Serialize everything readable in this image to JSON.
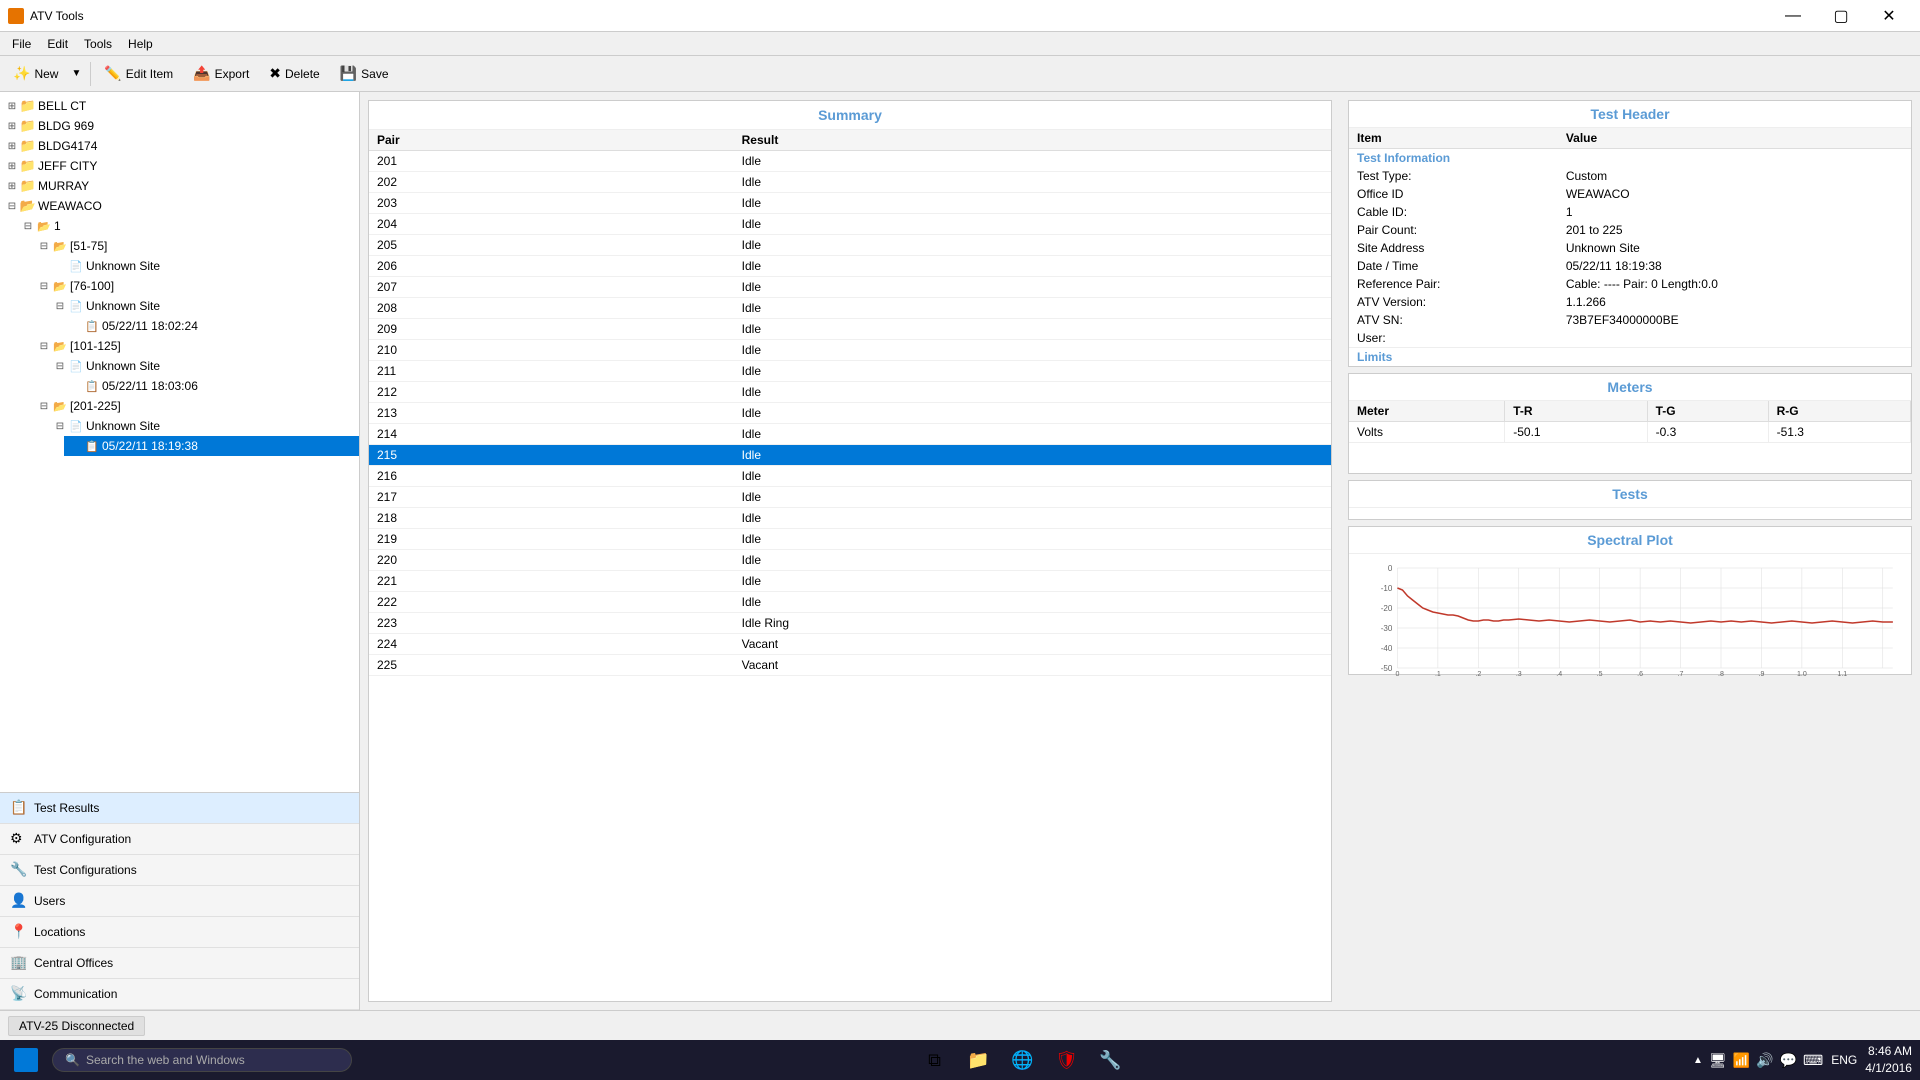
{
  "app": {
    "title": "ATV Tools",
    "title_icon": "ATV"
  },
  "menu": {
    "items": [
      "File",
      "Edit",
      "Tools",
      "Help"
    ]
  },
  "toolbar": {
    "new_label": "New",
    "edit_item_label": "Edit Item",
    "export_label": "Export",
    "delete_label": "Delete",
    "save_label": "Save"
  },
  "tree": {
    "items": [
      {
        "label": "BELL CT",
        "level": 0,
        "type": "root",
        "expanded": false
      },
      {
        "label": "BLDG 969",
        "level": 0,
        "type": "root",
        "expanded": false
      },
      {
        "label": "BLDG4174",
        "level": 0,
        "type": "root",
        "expanded": false
      },
      {
        "label": "JEFF CITY",
        "level": 0,
        "type": "root",
        "expanded": false
      },
      {
        "label": "MURRAY",
        "level": 0,
        "type": "root",
        "expanded": false
      },
      {
        "label": "WEAWACO",
        "level": 0,
        "type": "root",
        "expanded": true
      },
      {
        "label": "1",
        "level": 1,
        "type": "group",
        "expanded": true
      },
      {
        "label": "[51-75]",
        "level": 2,
        "type": "range",
        "expanded": true
      },
      {
        "label": "Unknown Site",
        "level": 3,
        "type": "site"
      },
      {
        "label": "[76-100]",
        "level": 2,
        "type": "range",
        "expanded": true
      },
      {
        "label": "Unknown Site",
        "level": 3,
        "type": "site",
        "expanded": true
      },
      {
        "label": "05/22/11 18:02:24",
        "level": 4,
        "type": "record"
      },
      {
        "label": "[101-125]",
        "level": 2,
        "type": "range",
        "expanded": true
      },
      {
        "label": "Unknown Site",
        "level": 3,
        "type": "site",
        "expanded": true
      },
      {
        "label": "05/22/11 18:03:06",
        "level": 4,
        "type": "record"
      },
      {
        "label": "[201-225]",
        "level": 2,
        "type": "range",
        "expanded": true
      },
      {
        "label": "Unknown Site",
        "level": 3,
        "type": "site",
        "expanded": true
      },
      {
        "label": "05/22/11 18:19:38",
        "level": 4,
        "type": "record",
        "selected": true
      }
    ]
  },
  "bottom_nav": {
    "items": [
      {
        "label": "Test Results",
        "icon": "📋",
        "active": true
      },
      {
        "label": "ATV Configuration",
        "icon": "⚙"
      },
      {
        "label": "Test Configurations",
        "icon": "🔧"
      },
      {
        "label": "Users",
        "icon": "👤"
      },
      {
        "label": "Locations",
        "icon": "📍"
      },
      {
        "label": "Central Offices",
        "icon": "🏢"
      },
      {
        "label": "Communication",
        "icon": "📡"
      }
    ]
  },
  "summary": {
    "title": "Summary",
    "col_pair": "Pair",
    "col_result": "Result",
    "rows": [
      {
        "pair": "201",
        "result": "Idle"
      },
      {
        "pair": "202",
        "result": "Idle"
      },
      {
        "pair": "203",
        "result": "Idle"
      },
      {
        "pair": "204",
        "result": "Idle"
      },
      {
        "pair": "205",
        "result": "Idle"
      },
      {
        "pair": "206",
        "result": "Idle"
      },
      {
        "pair": "207",
        "result": "Idle"
      },
      {
        "pair": "208",
        "result": "Idle"
      },
      {
        "pair": "209",
        "result": "Idle"
      },
      {
        "pair": "210",
        "result": "Idle"
      },
      {
        "pair": "211",
        "result": "Idle"
      },
      {
        "pair": "212",
        "result": "Idle"
      },
      {
        "pair": "213",
        "result": "Idle"
      },
      {
        "pair": "214",
        "result": "Idle"
      },
      {
        "pair": "215",
        "result": "Idle",
        "selected": true
      },
      {
        "pair": "216",
        "result": "Idle"
      },
      {
        "pair": "217",
        "result": "Idle"
      },
      {
        "pair": "218",
        "result": "Idle"
      },
      {
        "pair": "219",
        "result": "Idle"
      },
      {
        "pair": "220",
        "result": "Idle"
      },
      {
        "pair": "221",
        "result": "Idle"
      },
      {
        "pair": "222",
        "result": "Idle"
      },
      {
        "pair": "223",
        "result": "Idle Ring"
      },
      {
        "pair": "224",
        "result": "Vacant"
      },
      {
        "pair": "225",
        "result": "Vacant"
      }
    ]
  },
  "test_header": {
    "title": "Test Header",
    "col_item": "Item",
    "col_value": "Value",
    "section_test_info": "Test Information",
    "fields": [
      {
        "item": "Test Type:",
        "value": "Custom"
      },
      {
        "item": "Office ID",
        "value": "WEAWACO"
      },
      {
        "item": "Cable ID:",
        "value": "1"
      },
      {
        "item": "Pair Count:",
        "value": "201 to 225"
      },
      {
        "item": "Site Address",
        "value": "Unknown Site"
      },
      {
        "item": "Date / Time",
        "value": "05/22/11 18:19:38"
      },
      {
        "item": "Reference Pair:",
        "value": "Cable: ---- Pair: 0 Length:0.0"
      },
      {
        "item": "ATV Version:",
        "value": "1.1.266"
      },
      {
        "item": "ATV SN:",
        "value": "73B7EF34000000BE"
      },
      {
        "item": "User:",
        "value": ""
      }
    ],
    "section_limits": "Limits"
  },
  "meters": {
    "title": "Meters",
    "col_meter": "Meter",
    "col_tr": "T-R",
    "col_tg": "T-G",
    "col_rg": "R-G",
    "row_label": "Volts",
    "tr_value": "-50.1",
    "tg_value": "-0.3",
    "rg_value": "-51.3"
  },
  "tests": {
    "title": "Tests"
  },
  "spectral_plot": {
    "title": "Spectral Plot",
    "y_labels": [
      "0",
      "-10",
      "-20",
      "-30",
      "-40",
      "-50"
    ],
    "x_labels": [
      "0",
      ".1",
      ".2",
      ".3",
      ".4",
      ".5",
      ".6",
      ".7",
      ".8",
      ".9",
      "1.0",
      "1.1"
    ]
  },
  "status_bar": {
    "connection_status": "ATV-25 Disconnected"
  },
  "taskbar": {
    "search_placeholder": "Search the web and Windows",
    "time": "8:46 AM",
    "date": "4/1/2016",
    "lang": "ENG"
  }
}
